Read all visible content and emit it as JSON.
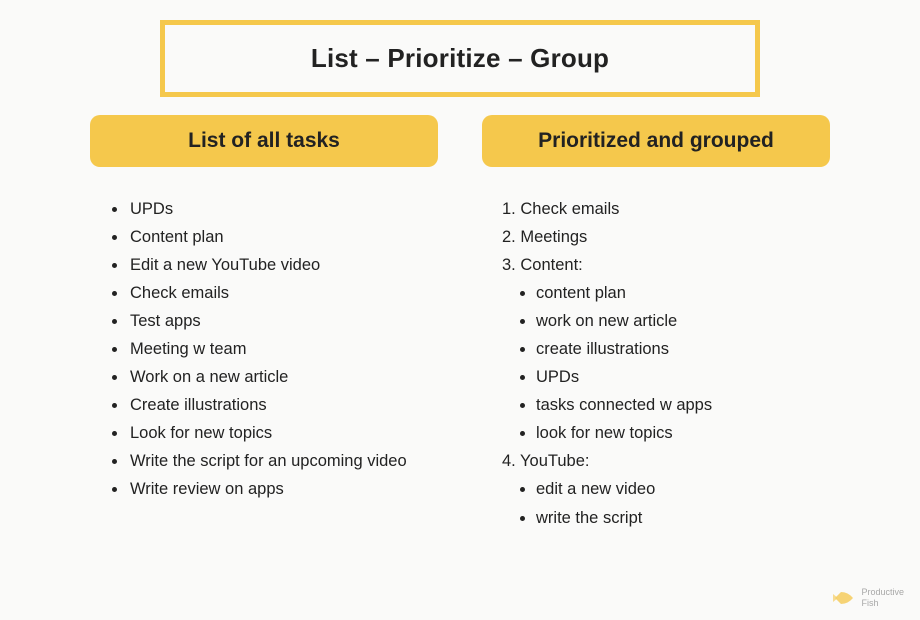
{
  "title": "List – Prioritize – Group",
  "leftHeader": "List of all tasks",
  "rightHeader": "Prioritized and grouped",
  "tasks": [
    "UPDs",
    "Content plan",
    "Edit a new YouTube video",
    "Check emails",
    "Test apps",
    "Meeting w team",
    "Work on a new article",
    "Create illustrations",
    "Look for new topics",
    "Write the script for an upcoming video",
    "Write review on apps"
  ],
  "prioritized": [
    {
      "num": "1.",
      "label": "Check emails",
      "sub": []
    },
    {
      "num": "2.",
      "label": "Meetings",
      "sub": []
    },
    {
      "num": "3.",
      "label": "Content:",
      "sub": [
        "content plan",
        "work on new article",
        "create illustrations",
        "UPDs",
        "tasks connected w apps",
        "look for new topics"
      ]
    },
    {
      "num": "4.",
      "label": "YouTube:",
      "sub": [
        "edit a new video",
        "write the script"
      ]
    }
  ],
  "logo": {
    "line1": "Productive",
    "line2": "Fish"
  }
}
